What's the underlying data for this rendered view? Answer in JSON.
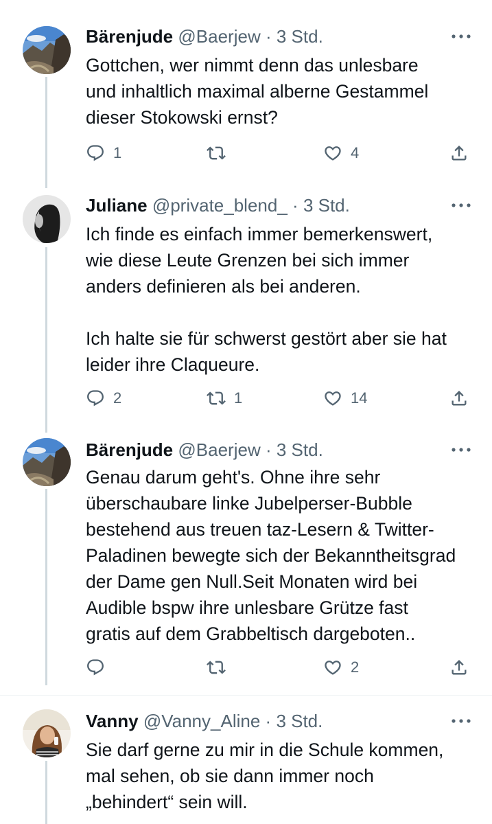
{
  "tweets": [
    {
      "name": "Bärenjude",
      "handle": "@Baerjew",
      "dot": "·",
      "time": "3 Std.",
      "avatar": "landscape-avatar",
      "text": "Gottchen, wer nimmt denn das  unlesbare\nund inhaltlich maximal alberne Gestammel\ndieser Stokowski ernst?",
      "replies": "1",
      "retweets": "",
      "likes": "4"
    },
    {
      "name": "Juliane",
      "handle": "@private_blend_",
      "dot": "·",
      "time": "3 Std.",
      "avatar": "bw-portrait-avatar",
      "text": "Ich finde es einfach immer bemerkenswert,\nwie diese Leute Grenzen bei sich immer\nanders definieren als bei anderen.\n\nIch halte sie für schwerst gestört aber sie hat\nleider ihre Claqueure.",
      "replies": "2",
      "retweets": "1",
      "likes": "14"
    },
    {
      "name": "Bärenjude",
      "handle": "@Baerjew",
      "dot": "·",
      "time": "3 Std.",
      "avatar": "landscape-avatar",
      "text": "Genau darum geht's. Ohne ihre sehr\nüberschaubare linke Jubelperser-Bubble\nbestehend aus treuen taz-Lesern & Twitter-\nPaladinen bewegte sich der Bekanntheitsgrad\nder Dame gen Null.Seit Monaten wird bei\nAudible bspw ihre unlesbare Grütze fast\ngratis auf dem Grabbeltisch dargeboten..",
      "replies": "",
      "retweets": "",
      "likes": "2"
    },
    {
      "name": "Vanny",
      "handle": "@Vanny_Aline",
      "dot": "·",
      "time": "3 Std.",
      "avatar": "photo-avatar",
      "text": "Sie darf gerne zu mir in die Schule kommen,\nmal sehen, ob sie dann immer noch\n„behindert“ sein will."
    }
  ],
  "icons": {
    "reply": "reply-icon",
    "retweet": "retweet-icon",
    "like": "heart-icon",
    "share": "share-icon",
    "more": "more-icon"
  },
  "colors": {
    "text": "#0f1419",
    "secondary": "#536471",
    "thread_line": "#cfd9de",
    "separator": "#eff3f4"
  }
}
